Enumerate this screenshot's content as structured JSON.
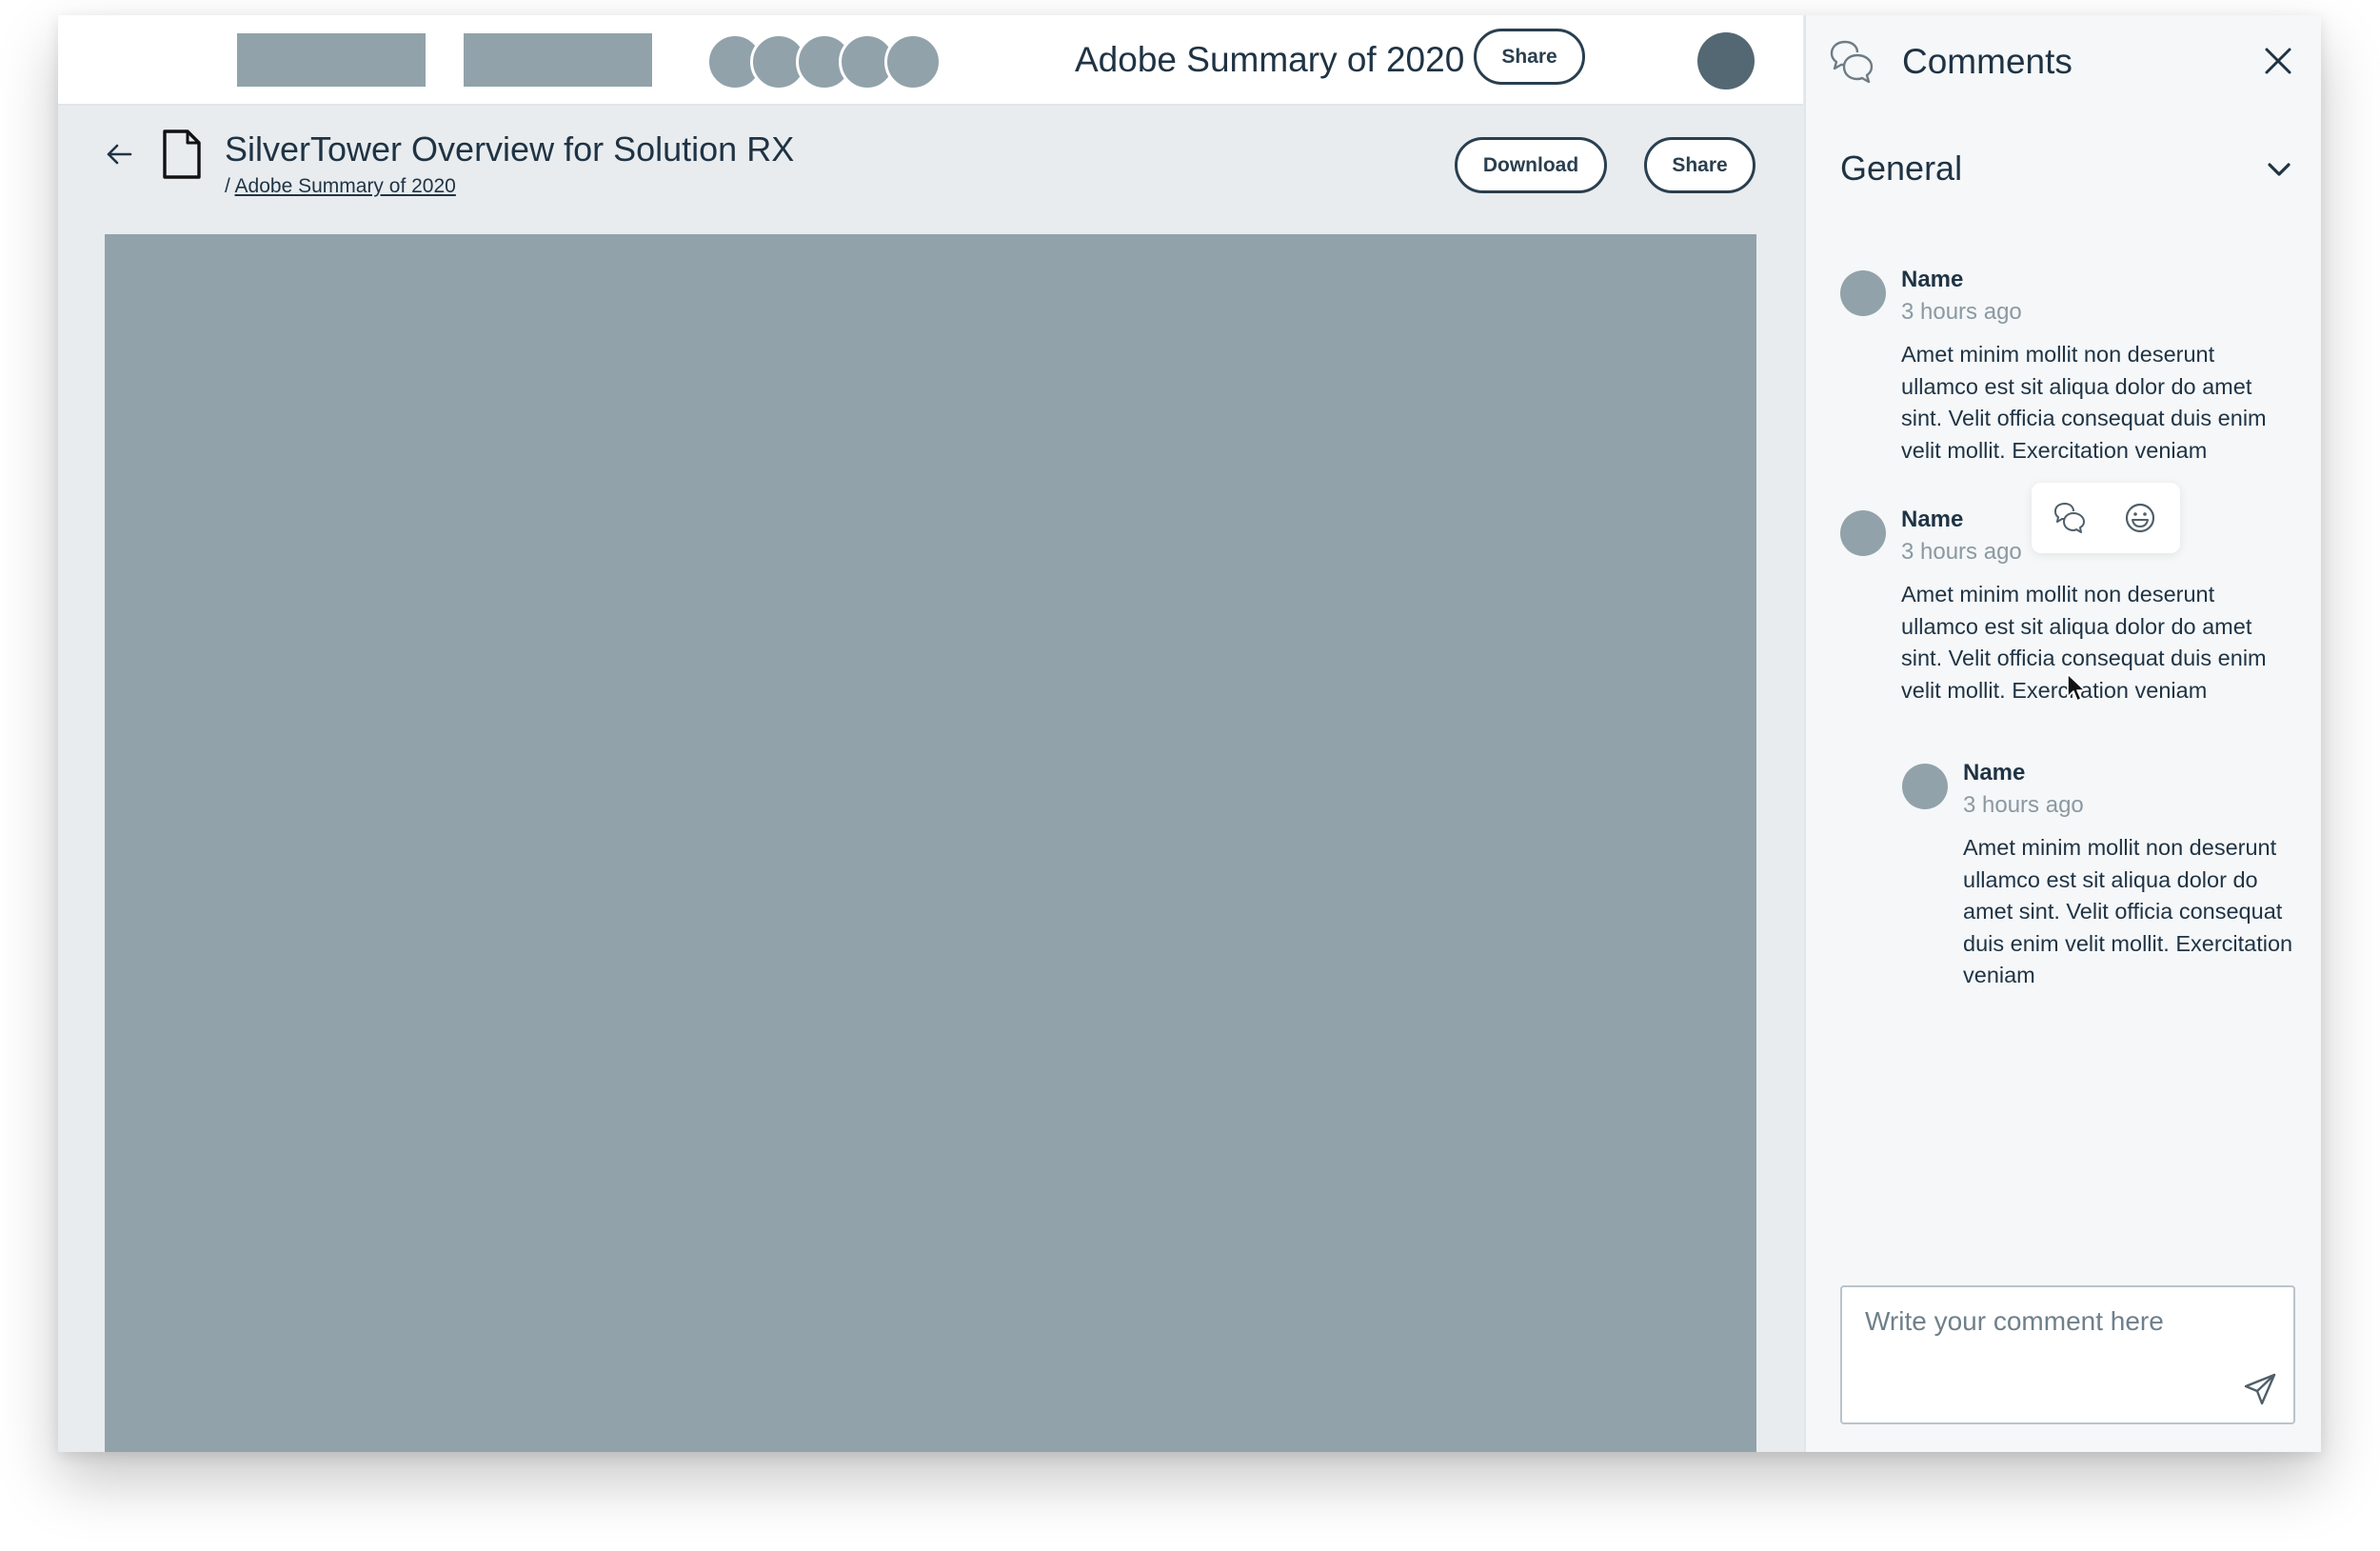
{
  "topbar": {
    "document_name": "Adobe Summary of 2020",
    "share_label": "Share"
  },
  "document": {
    "title": "SilverTower Overview for Solution RX",
    "breadcrumb_separator": "/",
    "breadcrumb_link": "Adobe Summary of 2020",
    "download_label": "Download",
    "share_label": "Share"
  },
  "comments_panel": {
    "title": "Comments",
    "section": "General",
    "comments": [
      {
        "name": "Name",
        "time": "3 hours ago",
        "text": "Amet minim mollit non deserunt ullamco est sit aliqua dolor do amet sint. Velit officia consequat duis enim velit mollit. Exercitation veniam"
      },
      {
        "name": "Name",
        "time": "3 hours ago",
        "text": "Amet minim mollit non deserunt ullamco est sit aliqua dolor do amet sint. Velit officia consequat duis enim velit mollit. Exercitation veniam"
      },
      {
        "name": "Name",
        "time": "3 hours ago",
        "text": "Amet minim mollit non deserunt ullamco est sit aliqua dolor do amet sint. Velit officia consequat duis enim velit mollit. Exercitation veniam"
      }
    ],
    "input_placeholder": "Write your comment here"
  },
  "colors": {
    "placeholder_gray": "#91a2aa",
    "user_avatar": "#546874",
    "text_dark": "#1f3344",
    "muted_text": "#8b99a3",
    "canvas_background": "#e8ecef",
    "panel_background": "#f5f7f8"
  },
  "icons": {
    "back": "arrow-left-icon",
    "file": "file-icon",
    "comments": "chat-bubbles-icon",
    "close": "close-icon",
    "collapse": "chevron-down-icon",
    "reply": "reply-icon",
    "react": "emoji-icon",
    "send": "send-icon"
  }
}
